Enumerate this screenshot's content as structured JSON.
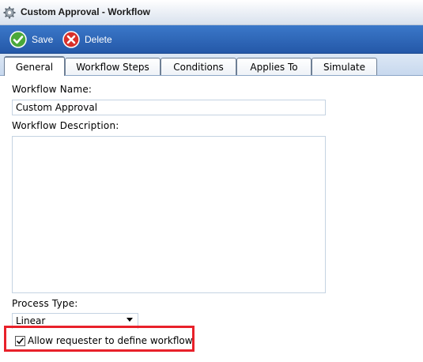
{
  "window": {
    "title": "Custom Approval - Workflow",
    "icon": "gear-icon"
  },
  "toolbar": {
    "save_label": "Save",
    "save_icon": "checkmark-circle-icon",
    "delete_label": "Delete",
    "delete_icon": "x-circle-icon"
  },
  "tabs": [
    {
      "label": "General",
      "active": true
    },
    {
      "label": "Workflow Steps",
      "active": false
    },
    {
      "label": "Conditions",
      "active": false
    },
    {
      "label": "Applies To",
      "active": false
    },
    {
      "label": "Simulate",
      "active": false
    }
  ],
  "form": {
    "name_label": "Workflow Name:",
    "name_value": "Custom Approval",
    "description_label": "Workflow Description:",
    "description_value": "",
    "process_type_label": "Process Type:",
    "process_type_value": "Linear",
    "allow_define_label": "Allow requester to define workflow",
    "allow_define_checked": true
  },
  "colors": {
    "toolbar": "#2458a8",
    "active_tab_accent": "#f0a030",
    "highlight_box": "#e8212a"
  }
}
